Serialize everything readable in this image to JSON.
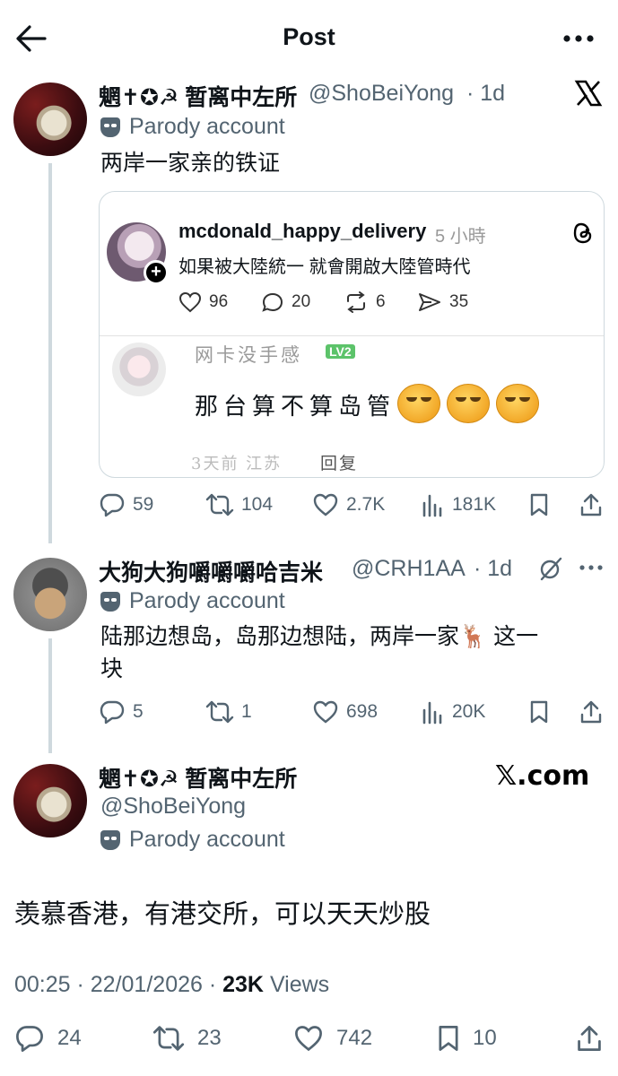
{
  "header": {
    "title": "Post"
  },
  "colors": {
    "text": "#0f1419",
    "secondary": "#536471",
    "line": "#cfd9de"
  },
  "icons": {
    "back": "arrow-left-icon",
    "more": "more-horizontal-icon",
    "platform": "x-logo-icon",
    "reply": "reply-icon",
    "repost": "repost-icon",
    "like": "heart-icon",
    "views": "views-icon",
    "bookmark": "bookmark-icon",
    "share": "share-icon",
    "threads": "threads-logo-icon",
    "grok": "grok-icon"
  },
  "post1": {
    "name": "魍✝︎✪☭ 暂离中左所",
    "handle": "@ShoBeiYong",
    "time": "· 1d",
    "badge": "Parody account",
    "text": "两岸一家亲的铁证",
    "embed": {
      "thread_user": "mcdonald_happy_delivery",
      "thread_time": "5 小時",
      "thread_text": "如果被大陸統一 就會開啟大陸管時代",
      "likes": "96",
      "replies": "20",
      "reposts": "6",
      "shares": "35",
      "comment_user": "网卡没手感",
      "comment_level": "LV2",
      "comment_text": "那台算不算岛管",
      "comment_meta": "3天前  江苏",
      "comment_reply": "回复"
    },
    "stats": {
      "replies": "59",
      "reposts": "104",
      "likes": "2.7K",
      "views": "181K"
    }
  },
  "post2": {
    "name": "大狗大狗嚼嚼嚼哈吉米",
    "handle": "@CRH1AA",
    "time": "· 1d",
    "badge": "Parody account",
    "text_line1": "陆那边想岛，岛那边想陆，两岸一家🦌 这一",
    "text_line2": "块",
    "stats": {
      "replies": "5",
      "reposts": "1",
      "likes": "698",
      "views": "20K"
    }
  },
  "main": {
    "name": "魍✝︎✪☭ 暂离中左所",
    "handle": "@ShoBeiYong",
    "badge": "Parody account",
    "watermark": "𝕏.com",
    "text": "羡慕香港，有港交所，可以天天炒股",
    "timestamp": "00:25 · 22/01/2026 · ",
    "views_count": "23K",
    "views_label": " Views",
    "stats": {
      "replies": "24",
      "reposts": "23",
      "likes": "742",
      "bookmarks": "10"
    }
  }
}
